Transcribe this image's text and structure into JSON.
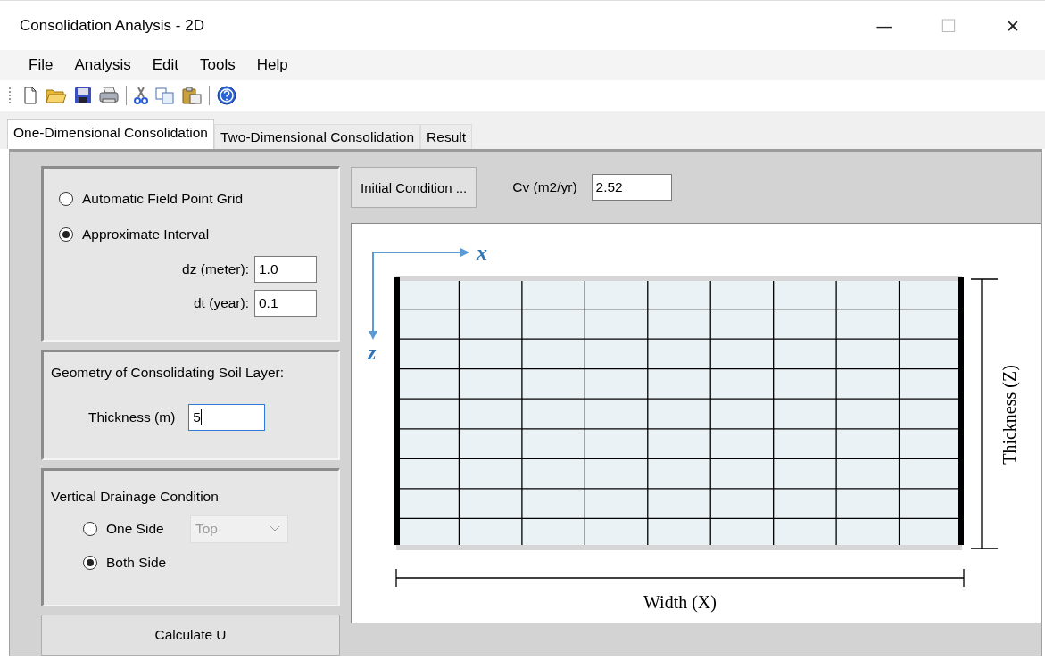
{
  "window": {
    "title": "Consolidation Analysis - 2D",
    "controls": [
      "—",
      "☐",
      "✕"
    ]
  },
  "menu": [
    "File",
    "Analysis",
    "Edit",
    "Tools",
    "Help"
  ],
  "tabs": [
    {
      "label": "One-Dimensional Consolidation",
      "selected": true
    },
    {
      "label": "Two-Dimensional Consolidation",
      "selected": false
    },
    {
      "label": "Result",
      "selected": false
    }
  ],
  "grid_options": {
    "radios": [
      {
        "label": "Automatic Field Point Grid",
        "selected": false
      },
      {
        "label": "Approximate Interval",
        "selected": true
      }
    ],
    "fields": [
      {
        "label": "dz (meter):",
        "value": "1.0"
      },
      {
        "label": "dt (year):",
        "value": "0.1"
      }
    ]
  },
  "geometry": {
    "title": "Geometry of Consolidating Soil Layer:",
    "field": {
      "label": "Thickness (m)",
      "value": "5",
      "focused": true
    }
  },
  "drainage": {
    "title": "Vertical Drainage Condition",
    "radios": [
      {
        "label": "One Side",
        "selected": false
      },
      {
        "label": "Both Side",
        "selected": true
      }
    ],
    "dropdown": {
      "value": "Top",
      "disabled": true
    }
  },
  "calculate_button": "Calculate U",
  "initial_condition_button": "Initial Condition ...",
  "cv_field": {
    "label": "Cv (m2/yr)",
    "value": "2.52"
  },
  "diagram": {
    "x_axis": "x",
    "z_axis": "z",
    "thickness_label": "Thickness (Z)",
    "width_label": "Width (X)"
  }
}
